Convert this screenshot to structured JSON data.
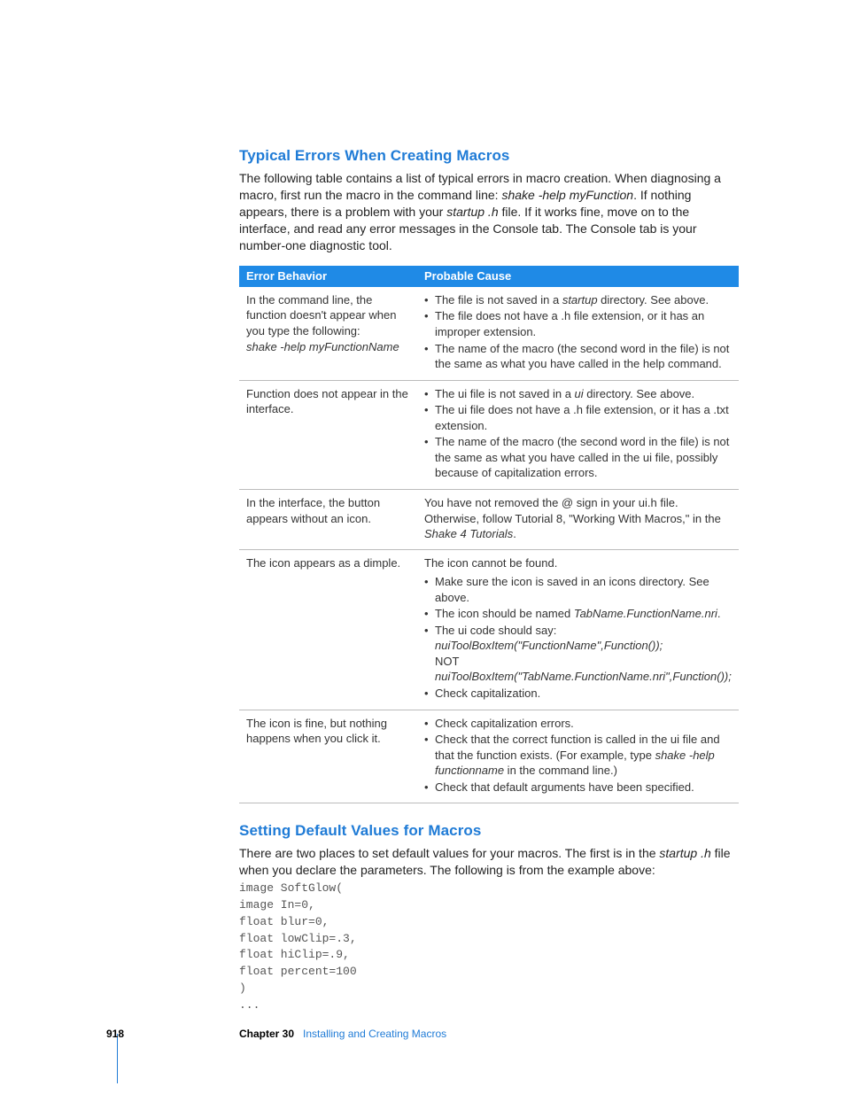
{
  "section1": {
    "heading": "Typical Errors When Creating Macros",
    "intro_pre": "The following table contains a list of typical errors in macro creation. When diagnosing a macro, first run the macro in the command line:  ",
    "intro_cmd": "shake -help myFunction",
    "intro_mid": ". If nothing appears, there is a problem with your ",
    "intro_file": "startup .h",
    "intro_post": " file. If it works fine, move on to the interface, and read any error messages in the Console tab. The Console tab is your number-one diagnostic tool."
  },
  "table": {
    "headers": [
      "Error Behavior",
      "Probable Cause"
    ],
    "rows": [
      {
        "behavior_lines": [
          "In the command line, the",
          "function doesn't appear when",
          "you type the following:"
        ],
        "behavior_italic": "shake -help myFunctionName",
        "cause_lead": null,
        "bullets": [
          {
            "pre": "The file is not saved in a ",
            "ital": "startup",
            "post": " directory. See above."
          },
          {
            "text": "The file does not have a .h file extension, or it has an improper extension."
          },
          {
            "text": "The name of the macro (the second word in the file) is not the same as what you have called in the help command."
          }
        ]
      },
      {
        "behavior_lines": [
          "Function does not appear in the",
          "interface."
        ],
        "behavior_italic": null,
        "cause_lead": null,
        "bullets": [
          {
            "pre": "The ui file is not saved in a ",
            "ital": "ui",
            "post": " directory. See above."
          },
          {
            "text": "The ui file does not have a .h file extension, or it has a .txt extension."
          },
          {
            "text": "The name of the macro (the second word in the file) is not the same as what you have called in the ui file, possibly because of capitalization errors."
          }
        ]
      },
      {
        "behavior_lines": [
          "In the interface, the button",
          "appears without an icon."
        ],
        "behavior_italic": null,
        "cause_plain_pre": "You have not removed the @ sign in your ui.h file. Otherwise, follow Tutorial 8, \"Working With Macros,\" in the ",
        "cause_plain_ital": "Shake 4 Tutorials",
        "cause_plain_post": "."
      },
      {
        "behavior_lines": [
          "The icon appears as a dimple."
        ],
        "behavior_italic": null,
        "cause_lead": "The icon cannot be found.",
        "bullets": [
          {
            "text": "Make sure the icon is saved in an icons directory. See above."
          },
          {
            "pre": "The icon should be named ",
            "ital": "TabName.FunctionName.nri",
            "post": "."
          },
          {
            "multi": [
              {
                "t": "The ui code should say:"
              },
              {
                "i": "nuiToolBoxItem(\"FunctionName\",Function());"
              },
              {
                "t": "NOT"
              },
              {
                "i": "nuiToolBoxItem(\"TabName.FunctionName.nri\",Function());"
              }
            ]
          },
          {
            "text": "Check capitalization."
          }
        ]
      },
      {
        "behavior_lines": [
          "The icon is fine, but nothing",
          "happens when you click it."
        ],
        "behavior_italic": null,
        "bullets": [
          {
            "text": "Check capitalization errors."
          },
          {
            "pre": "Check that the correct function is called in the ui file and that the function exists. (For example, type ",
            "ital": "shake -help functionname",
            "post": " in the command line.)"
          },
          {
            "text": "Check that default arguments have been specified."
          }
        ]
      }
    ]
  },
  "section2": {
    "heading": "Setting Default Values for Macros",
    "intro_pre": "There are two places to set default values for your macros. The first is in the ",
    "intro_ital": "startup .h",
    "intro_post": " file when you declare the parameters. The following is from the example above:",
    "code": "image SoftGlow(\nimage In=0,\nfloat blur=0,\nfloat lowClip=.3,\nfloat hiClip=.9,\nfloat percent=100\n)\n..."
  },
  "footer": {
    "page": "918",
    "chapter": "Chapter 30",
    "title": "Installing and Creating Macros"
  }
}
